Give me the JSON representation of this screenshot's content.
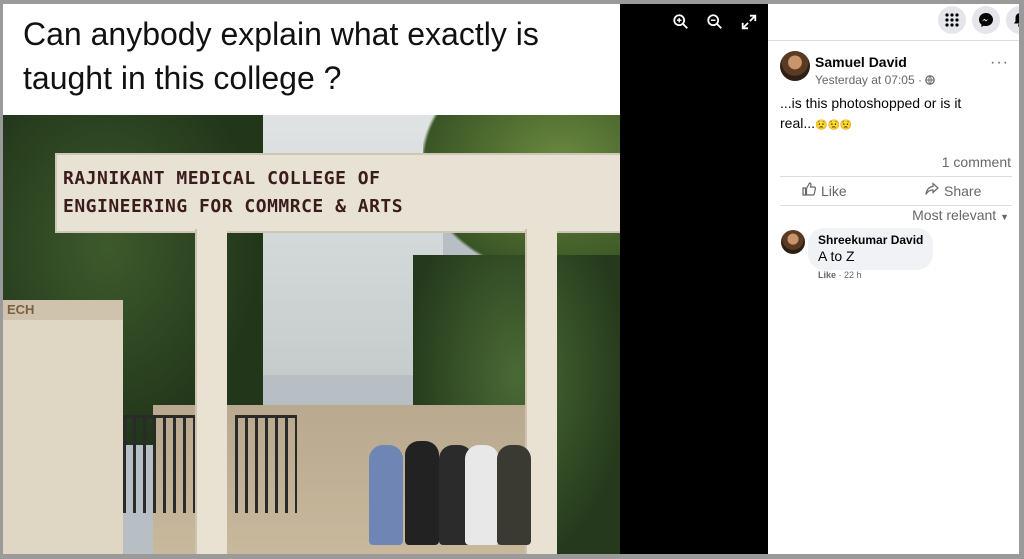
{
  "image": {
    "caption": "Can anybody explain what exactly is taught in this college ?",
    "sign_line1": "RAJNIKANT MEDICAL COLLEGE OF",
    "sign_line2": "ENGINEERING FOR COMMRCE & ARTS",
    "booth_sign": "ECH"
  },
  "viewer_tools": {
    "zoom_in": "zoom-in-icon",
    "zoom_out": "zoom-out-icon",
    "fullscreen": "expand-icon"
  },
  "topbar_icons": [
    "apps-grid-icon",
    "messenger-icon",
    "notifications-icon"
  ],
  "post": {
    "author": "Samuel David",
    "time": "Yesterday at 07:05",
    "separator": "·",
    "privacy_icon": "globe-icon",
    "more": "···",
    "text": "...is this photoshopped or is it real...",
    "emojis": "😟😟😟",
    "comment_count": "1 comment"
  },
  "actions": {
    "like": "Like",
    "share": "Share"
  },
  "comments": {
    "sort_label": "Most relevant",
    "items": [
      {
        "name": "Shreekumar David",
        "text": "A to Z",
        "like": "Like",
        "separator": "·",
        "age": "22 h"
      }
    ]
  },
  "colors": {
    "panel_bg": "#ffffff",
    "viewer_bg": "#000000",
    "muted_text": "#65676b",
    "bubble_bg": "#f0f2f5"
  }
}
